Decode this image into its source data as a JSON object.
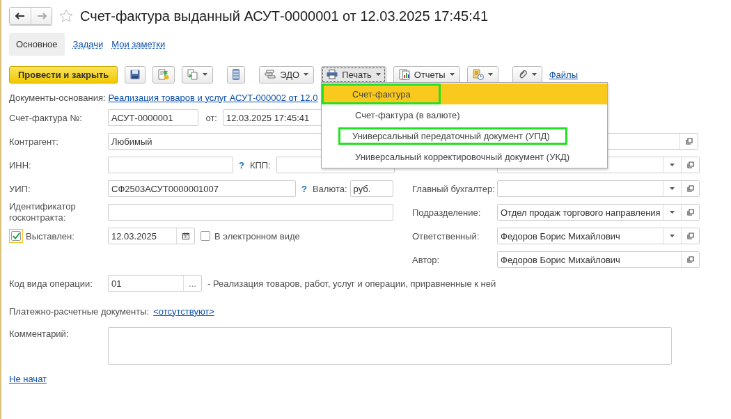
{
  "window": {
    "title": "Счет-фактура выданный АСУТ-0000001 от 12.03.2025 17:45:41",
    "favorite": false
  },
  "tabs": [
    {
      "label": "Основное",
      "selected": true
    },
    {
      "label": "Задачи",
      "selected": false
    },
    {
      "label": "Мои заметки",
      "selected": false
    }
  ],
  "toolbar": [
    {
      "kind": "primary",
      "label": "Провести и закрыть"
    },
    {
      "kind": "icon"
    },
    {
      "kind": "icon"
    },
    {
      "kind": "icon_menu"
    },
    {
      "kind": "icon"
    },
    {
      "kind": "menu",
      "label": "ЭДО",
      "pressed": false
    },
    {
      "kind": "menu",
      "label": "Печать",
      "pressed": true
    },
    {
      "kind": "menu",
      "label": "Отчеты",
      "pressed": false
    },
    {
      "kind": "icon_menu"
    },
    {
      "kind": "icon_menu"
    },
    {
      "kind": "link",
      "label": "Файлы"
    }
  ],
  "print_menu": [
    {
      "label": "Счет-фактура",
      "selected": true,
      "annotated": true
    },
    {
      "label": "Счет-фактура (в валюте)",
      "selected": false,
      "annotated": false
    },
    {
      "label": "Универсальный передаточный документ (УПД)",
      "selected": false,
      "annotated": true
    },
    {
      "label": "Универсальный корректировочный документ (УКД)",
      "selected": false,
      "annotated": false
    }
  ],
  "form": {
    "base_documents": {
      "label": "Документы-основания:",
      "link": "Реализация товаров и услуг АСУТ-000002 от 12.0"
    },
    "invoice_number": {
      "label": "Счет-фактура №:",
      "value": "АСУТ-0000001"
    },
    "date": {
      "label": "от:",
      "value": "12.03.2025 17:45:41"
    },
    "counterparty": {
      "label": "Контрагент:",
      "value": "Любимый"
    },
    "inn": {
      "label": "ИНН:",
      "help": "?"
    },
    "kpp": {
      "label": "КПП:"
    },
    "uip": {
      "label": "УИП:",
      "value": "СФ2503АСУТ0000001007",
      "help": "?"
    },
    "currency": {
      "label": "Валюта:",
      "value": "руб."
    },
    "contract_id": {
      "label": "Идентификатор госконтракта:"
    },
    "issued": {
      "label": "Выставлен:",
      "checked": true,
      "date": "12.03.2025"
    },
    "electronic": {
      "label": "В электронном виде",
      "checked": false
    },
    "operation_code": {
      "label": "Код вида операции:",
      "value": "01",
      "button": "...",
      "description": "- Реализация товаров, работ, услуг и операции, приравненные к ней"
    },
    "payment_documents": {
      "label": "Платежно-расчетные документы:",
      "link": "<отсутствуют>"
    },
    "comment": {
      "label": "Комментарий:"
    },
    "status_link": "Не начат"
  },
  "right_fields": [
    {
      "dropdown": true
    },
    {
      "label": "Главный бухгалтер:",
      "dropdown": true
    },
    {
      "label": "Подразделение:",
      "value": "Отдел продаж торгового направления",
      "dropdown": true
    },
    {
      "label": "Ответственный:",
      "value": "Федоров Борис Михайлович",
      "dropdown": true
    },
    {
      "label": "Автор:",
      "value": "Федоров Борис Михайлович",
      "dropdown": false
    }
  ]
}
